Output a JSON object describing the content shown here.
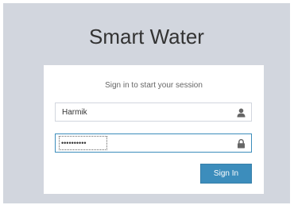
{
  "app": {
    "title": "Smart Water"
  },
  "login": {
    "message": "Sign in to start your session",
    "username_value": "Harmik",
    "username_icon": "user-icon",
    "password_value": "••••••••••",
    "password_icon": "lock-icon",
    "signin_label": "Sign In"
  },
  "colors": {
    "page_background": "#d2d6de",
    "box_background": "#ffffff",
    "accent": "#3c8dbc",
    "focus_border": "#3c8dbc",
    "icon": "#666666"
  }
}
